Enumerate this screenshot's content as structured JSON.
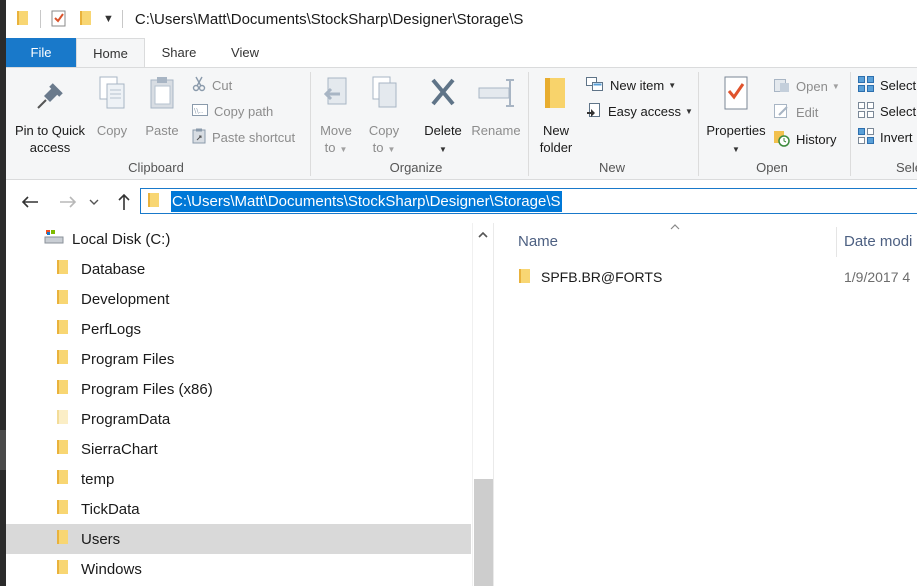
{
  "window": {
    "title": "C:\\Users\\Matt\\Documents\\StockSharp\\Designer\\Storage\\S"
  },
  "tabs": {
    "file": "File",
    "home": "Home",
    "share": "Share",
    "view": "View"
  },
  "ribbon": {
    "clipboard": {
      "label": "Clipboard",
      "pin_line1": "Pin to Quick",
      "pin_line2": "access",
      "copy": "Copy",
      "paste": "Paste",
      "cut": "Cut",
      "copy_path": "Copy path",
      "paste_shortcut": "Paste shortcut"
    },
    "organize": {
      "label": "Organize",
      "move_to_1": "Move",
      "move_to_2": "to",
      "copy_to_1": "Copy",
      "copy_to_2": "to",
      "delete": "Delete",
      "rename": "Rename"
    },
    "new": {
      "label": "New",
      "new_folder_1": "New",
      "new_folder_2": "folder",
      "new_item": "New item",
      "easy_access": "Easy access"
    },
    "open": {
      "label": "Open",
      "properties": "Properties",
      "open": "Open",
      "edit": "Edit",
      "history": "History"
    },
    "select": {
      "label": "Sele",
      "select_all": "Select",
      "select_none": "Select",
      "invert": "Invert"
    }
  },
  "address": {
    "path": "C:\\Users\\Matt\\Documents\\StockSharp\\Designer\\Storage\\S"
  },
  "nav_tree": {
    "drive": "Local Disk (C:)",
    "folders": [
      "Database",
      "Development",
      "PerfLogs",
      "Program Files",
      "Program Files (x86)",
      "ProgramData",
      "SierraChart",
      "temp",
      "TickData",
      "Users",
      "Windows"
    ],
    "selected": "Users"
  },
  "content": {
    "col_name": "Name",
    "col_date": "Date modi",
    "rows": [
      {
        "name": "SPFB.BR@FORTS",
        "date": "1/9/2017 4"
      }
    ]
  },
  "colors": {
    "accent": "#1979ca",
    "selection": "#0078d7",
    "folder": "#f8c94a"
  }
}
